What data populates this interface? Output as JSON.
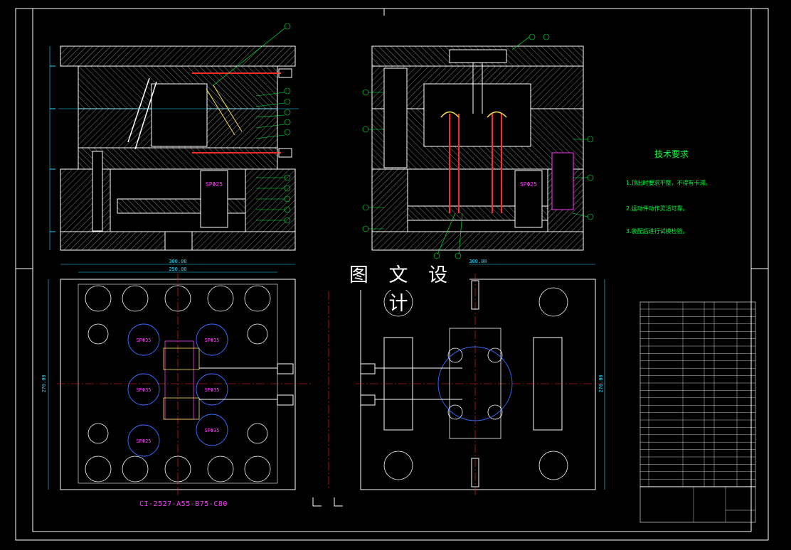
{
  "watermark": "图 文 设 计",
  "part_code": "CI-2527-A55-B75-C80",
  "technical_requirements": {
    "title": "技术要求",
    "lines": [
      "1.顶出时要求平整，不得有卡滞。",
      "2.运动件动作灵活可靠。",
      "3.装配后进行试模检验。"
    ]
  },
  "dimensions": {
    "top_width_outer": "300.00",
    "top_width_inner": "250.00",
    "right_width_outer": "300.00",
    "side_height_left": "270.00",
    "side_height_right": "270.00"
  },
  "pins": [
    "SP Φ 25",
    "SP Φ 25",
    "SP Φ 35",
    "SP Φ 35",
    "SP Φ 35",
    "SP Φ 35",
    "SP Φ 35",
    "SP Φ 25",
    "SP Φ 25"
  ],
  "colors": {
    "background": "#000000",
    "frame": "#ffffff",
    "hatch": "#e8e8e8",
    "leader": "#00ff3a",
    "center": "#ff2a2a",
    "dim": "#2ad8ff",
    "text_mag": "#ff3aff",
    "yellow": "#ffe14a",
    "blue": "#3a6bff"
  }
}
